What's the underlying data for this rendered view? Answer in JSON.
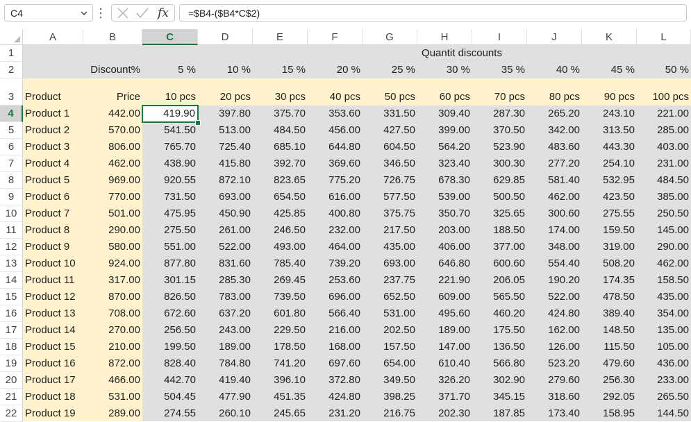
{
  "name_box": {
    "value": "C4"
  },
  "formula_bar": {
    "fx_label": "fx",
    "formula": "=$B4-($B4*C$2)"
  },
  "columns": [
    "A",
    "B",
    "C",
    "D",
    "E",
    "F",
    "G",
    "H",
    "I",
    "J",
    "K",
    "L"
  ],
  "selected_column": "C",
  "selected_row": "4",
  "title": "Quantit discounts",
  "row2": {
    "label": "Discount%",
    "values": [
      "5 %",
      "10 %",
      "15 %",
      "20 %",
      "25 %",
      "30 %",
      "35 %",
      "40 %",
      "45 %",
      "50 %"
    ]
  },
  "row3": {
    "product_header": "Product",
    "price_header": "Price",
    "values": [
      "10 pcs",
      "20 pcs",
      "30 pcs",
      "40 pcs",
      "50 pcs",
      "60 pcs",
      "70 pcs",
      "80 pcs",
      "90 pcs",
      "100 pcs"
    ]
  },
  "rows": [
    {
      "n": "4",
      "product": "Product 1",
      "price": "442.00",
      "values": [
        "419.90",
        "397.80",
        "375.70",
        "353.60",
        "331.50",
        "309.40",
        "287.30",
        "265.20",
        "243.10",
        "221.00"
      ]
    },
    {
      "n": "5",
      "product": "Product 2",
      "price": "570.00",
      "values": [
        "541.50",
        "513.00",
        "484.50",
        "456.00",
        "427.50",
        "399.00",
        "370.50",
        "342.00",
        "313.50",
        "285.00"
      ]
    },
    {
      "n": "6",
      "product": "Product 3",
      "price": "806.00",
      "values": [
        "765.70",
        "725.40",
        "685.10",
        "644.80",
        "604.50",
        "564.20",
        "523.90",
        "483.60",
        "443.30",
        "403.00"
      ]
    },
    {
      "n": "7",
      "product": "Product 4",
      "price": "462.00",
      "values": [
        "438.90",
        "415.80",
        "392.70",
        "369.60",
        "346.50",
        "323.40",
        "300.30",
        "277.20",
        "254.10",
        "231.00"
      ]
    },
    {
      "n": "8",
      "product": "Product 5",
      "price": "969.00",
      "values": [
        "920.55",
        "872.10",
        "823.65",
        "775.20",
        "726.75",
        "678.30",
        "629.85",
        "581.40",
        "532.95",
        "484.50"
      ]
    },
    {
      "n": "9",
      "product": "Product 6",
      "price": "770.00",
      "values": [
        "731.50",
        "693.00",
        "654.50",
        "616.00",
        "577.50",
        "539.00",
        "500.50",
        "462.00",
        "423.50",
        "385.00"
      ]
    },
    {
      "n": "10",
      "product": "Product 7",
      "price": "501.00",
      "values": [
        "475.95",
        "450.90",
        "425.85",
        "400.80",
        "375.75",
        "350.70",
        "325.65",
        "300.60",
        "275.55",
        "250.50"
      ]
    },
    {
      "n": "11",
      "product": "Product 8",
      "price": "290.00",
      "values": [
        "275.50",
        "261.00",
        "246.50",
        "232.00",
        "217.50",
        "203.00",
        "188.50",
        "174.00",
        "159.50",
        "145.00"
      ]
    },
    {
      "n": "12",
      "product": "Product 9",
      "price": "580.00",
      "values": [
        "551.00",
        "522.00",
        "493.00",
        "464.00",
        "435.00",
        "406.00",
        "377.00",
        "348.00",
        "319.00",
        "290.00"
      ]
    },
    {
      "n": "13",
      "product": "Product 10",
      "price": "924.00",
      "values": [
        "877.80",
        "831.60",
        "785.40",
        "739.20",
        "693.00",
        "646.80",
        "600.60",
        "554.40",
        "508.20",
        "462.00"
      ]
    },
    {
      "n": "14",
      "product": "Product 11",
      "price": "317.00",
      "values": [
        "301.15",
        "285.30",
        "269.45",
        "253.60",
        "237.75",
        "221.90",
        "206.05",
        "190.20",
        "174.35",
        "158.50"
      ]
    },
    {
      "n": "15",
      "product": "Product 12",
      "price": "870.00",
      "values": [
        "826.50",
        "783.00",
        "739.50",
        "696.00",
        "652.50",
        "609.00",
        "565.50",
        "522.00",
        "478.50",
        "435.00"
      ]
    },
    {
      "n": "16",
      "product": "Product 13",
      "price": "708.00",
      "values": [
        "672.60",
        "637.20",
        "601.80",
        "566.40",
        "531.00",
        "495.60",
        "460.20",
        "424.80",
        "389.40",
        "354.00"
      ]
    },
    {
      "n": "17",
      "product": "Product 14",
      "price": "270.00",
      "values": [
        "256.50",
        "243.00",
        "229.50",
        "216.00",
        "202.50",
        "189.00",
        "175.50",
        "162.00",
        "148.50",
        "135.00"
      ]
    },
    {
      "n": "18",
      "product": "Product 15",
      "price": "210.00",
      "values": [
        "199.50",
        "189.00",
        "178.50",
        "168.00",
        "157.50",
        "147.00",
        "136.50",
        "126.00",
        "115.50",
        "105.00"
      ]
    },
    {
      "n": "19",
      "product": "Product 16",
      "price": "872.00",
      "values": [
        "828.40",
        "784.80",
        "741.20",
        "697.60",
        "654.00",
        "610.40",
        "566.80",
        "523.20",
        "479.60",
        "436.00"
      ]
    },
    {
      "n": "20",
      "product": "Product 17",
      "price": "466.00",
      "values": [
        "442.70",
        "419.40",
        "396.10",
        "372.80",
        "349.50",
        "326.20",
        "302.90",
        "279.60",
        "256.30",
        "233.00"
      ]
    },
    {
      "n": "21",
      "product": "Product 18",
      "price": "531.00",
      "values": [
        "504.45",
        "477.90",
        "451.35",
        "424.80",
        "398.25",
        "371.70",
        "345.15",
        "318.60",
        "292.05",
        "265.50"
      ]
    },
    {
      "n": "22",
      "product": "Product 19",
      "price": "289.00",
      "values": [
        "274.55",
        "260.10",
        "245.65",
        "231.20",
        "216.75",
        "202.30",
        "187.85",
        "173.40",
        "158.95",
        "144.50"
      ]
    }
  ]
}
